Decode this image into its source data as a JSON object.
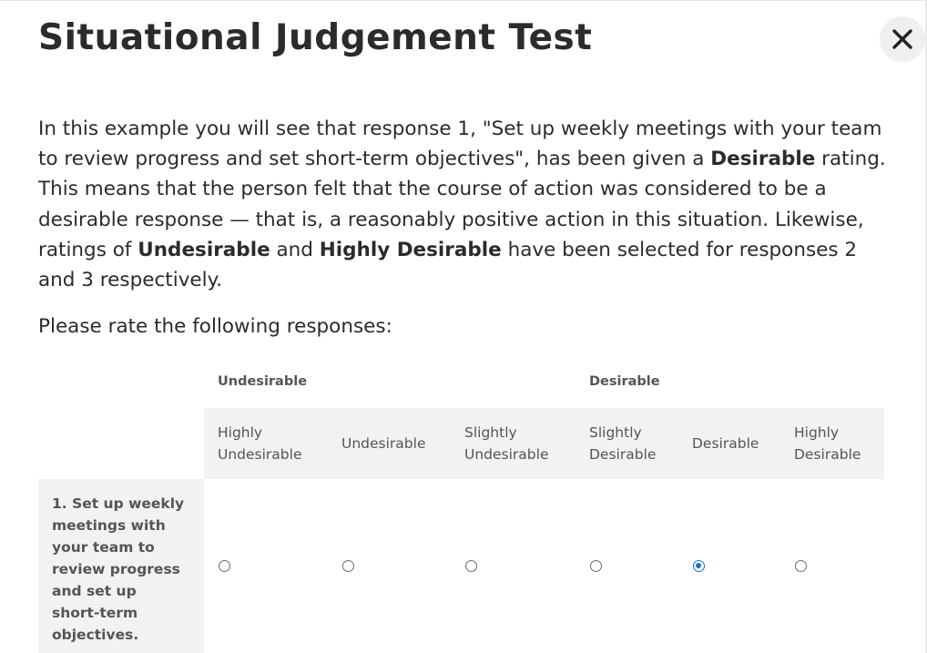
{
  "dialog": {
    "title": "Situational Judgement Test",
    "close_label": "close"
  },
  "intro": {
    "p1": "In this example you will see that response 1, \"Set up weekly meetings with your team to review progress and set short-term objectives\", has been given a ",
    "b1": "Desirable",
    "p2": " rating. This means that the person felt that the course of action was considered to be a desirable response — that is, a reasonably positive action in this situation. Likewise, ratings of ",
    "b2": "Undesirable",
    "p3": " and ",
    "b3": "Highly Desirable",
    "p4": " have been selected for responses 2 and 3 respectively."
  },
  "prompt": "Please rate the following responses:",
  "table": {
    "group_headers": [
      "Undesirable",
      "Desirable"
    ],
    "columns": [
      {
        "line1": "Highly",
        "line2": "Undesirable"
      },
      {
        "line1": "Undesirable",
        "line2": ""
      },
      {
        "line1": "Slightly",
        "line2": "Undesirable"
      },
      {
        "line1": "Slightly",
        "line2": "Desirable"
      },
      {
        "line1": "Desirable",
        "line2": ""
      },
      {
        "line1": "Highly",
        "line2": "Desirable"
      }
    ],
    "rows": [
      {
        "label_lines": [
          "1. Set up weekly",
          "meetings with",
          "your team to",
          "review progress",
          "and set up",
          "short-term",
          "objectives."
        ],
        "selected": "Desirable"
      }
    ]
  },
  "accent_color": "#1a73c8"
}
